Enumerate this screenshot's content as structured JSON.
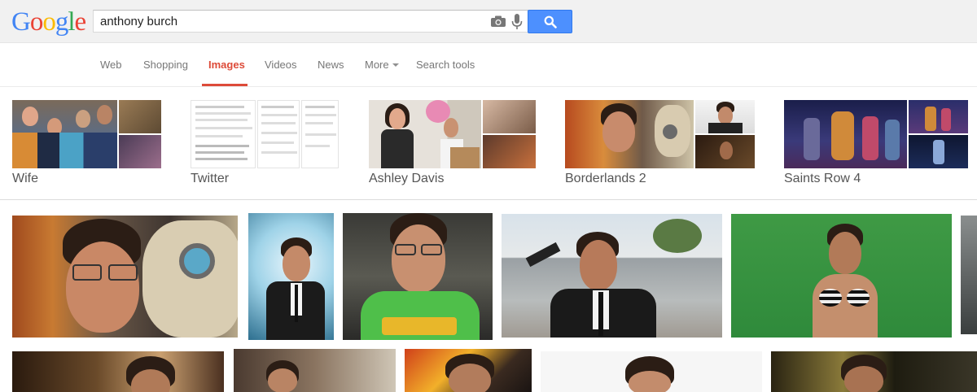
{
  "logo": {
    "text": "Google",
    "letters": [
      "G",
      "o",
      "o",
      "g",
      "l",
      "e"
    ],
    "colors": [
      "#4285f4",
      "#ea4335",
      "#fbbc05",
      "#4285f4",
      "#34a853",
      "#ea4335"
    ]
  },
  "search": {
    "query": "anthony burch",
    "placeholder": ""
  },
  "icons": {
    "camera": "camera-icon",
    "mic": "mic-icon",
    "search": "search-icon"
  },
  "nav": {
    "items": [
      "Web",
      "Shopping",
      "Images",
      "Videos",
      "News",
      "More",
      "Search tools"
    ],
    "active": "Images"
  },
  "related": [
    {
      "label": "Wife"
    },
    {
      "label": "Twitter"
    },
    {
      "label": "Ashley Davis"
    },
    {
      "label": "Borderlands 2"
    },
    {
      "label": "Saints Row 4"
    }
  ],
  "colors": {
    "accent": "#dd4b39",
    "button": "#4d90fe",
    "topbar": "#f1f1f1"
  }
}
